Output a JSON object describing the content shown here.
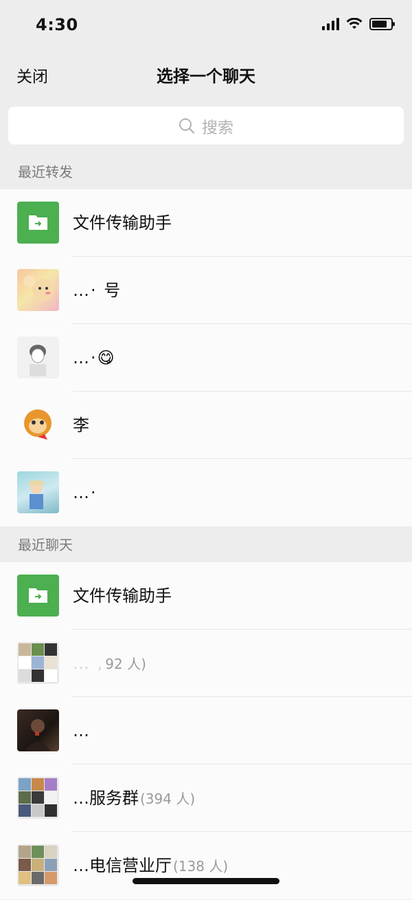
{
  "status": {
    "time": "4:30",
    "icons": [
      "signal-icon",
      "wifi-icon",
      "battery-icon"
    ],
    "battery_level": 0.8
  },
  "nav": {
    "close_label": "关闭",
    "title": "选择一个聊天"
  },
  "search": {
    "placeholder": "搜索",
    "icon": "search-icon"
  },
  "sections": {
    "recent_forward": {
      "header": "最近转发",
      "items": [
        {
          "name": "文件传输助手",
          "avatar": "file-transfer-icon",
          "color": "#4caf50"
        },
        {
          "name": "…· 号",
          "avatar": "cartoon-avatar"
        },
        {
          "name": "…·😋",
          "avatar": "sketch-avatar"
        },
        {
          "name": "李",
          "avatar": "monkey-avatar"
        },
        {
          "name": "…·",
          "avatar": "photo-avatar"
        }
      ]
    },
    "recent_chat": {
      "header": "最近聊天",
      "items": [
        {
          "name": "… ,",
          "count": "92 人)",
          "avatar": "group-avatar"
        },
        {
          "name": "文件传输助手",
          "avatar": "file-transfer-icon",
          "color": "#4caf50"
        },
        {
          "name": "…",
          "avatar": "dark-photo-avatar"
        },
        {
          "name": "…服务群",
          "count": "(394 人)",
          "avatar": "group-avatar"
        },
        {
          "name": "…电信营业厅",
          "count": "(138 人)",
          "avatar": "group-avatar"
        }
      ]
    }
  }
}
